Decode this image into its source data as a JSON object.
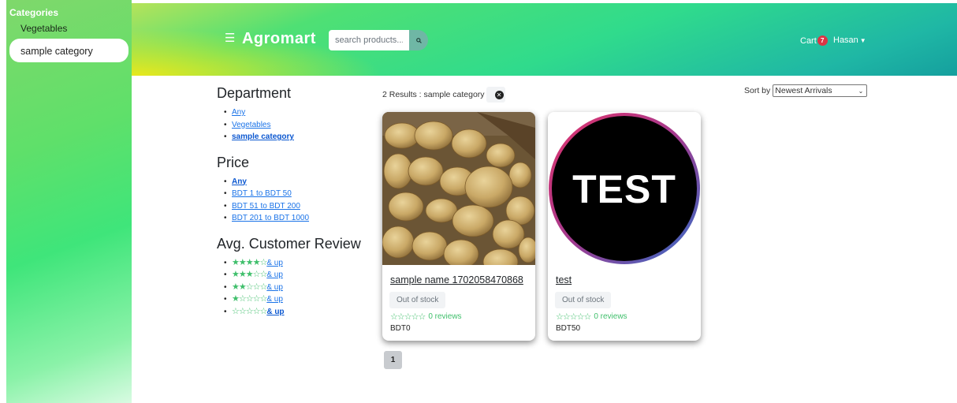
{
  "sidebar": {
    "title": "Categories",
    "items": [
      {
        "label": "Vegetables"
      },
      {
        "label": "sample category",
        "active": true
      }
    ]
  },
  "header": {
    "brand": "Agromart",
    "search_placeholder": "search products...",
    "cart_label": "Cart",
    "cart_count": "7",
    "user_name": "Hasan"
  },
  "filters": {
    "department_title": "Department",
    "department_items": [
      "Any",
      "Vegetables",
      "sample category"
    ],
    "price_title": "Price",
    "price_items": [
      "Any",
      "BDT 1 to BDT 50",
      "BDT 51 to BDT 200",
      "BDT 201 to BDT 1000"
    ],
    "review_title": "Avg. Customer Review",
    "review_up_label": "& up",
    "review_ratings": [
      4,
      3,
      2,
      1,
      0
    ]
  },
  "results": {
    "summary": "2 Results : sample category"
  },
  "sort": {
    "label": "Sort by",
    "selected": "Newest Arrivals"
  },
  "products": [
    {
      "title": "sample name 1702058470868",
      "status": "Out of stock",
      "rating": 0,
      "reviews": "0 reviews",
      "price": "BDT0"
    },
    {
      "title": "test",
      "logo_text": "TEST",
      "status": "Out of stock",
      "rating": 0,
      "reviews": "0 reviews",
      "price": "BDT50"
    }
  ],
  "pagination": {
    "current_page": "1"
  },
  "colors": {
    "accent_green": "#3fbf6b",
    "link_blue": "#1a73e8",
    "badge_red": "#dc3545"
  }
}
